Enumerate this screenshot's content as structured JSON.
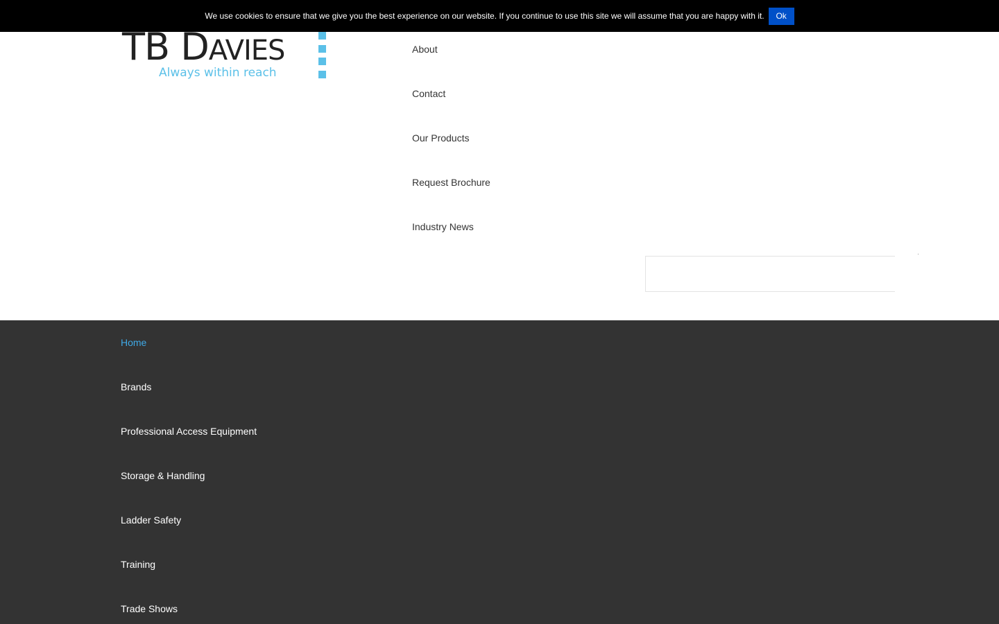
{
  "cookie_bar": {
    "message": "We use cookies to ensure that we give you the best experience on our website. If you continue to use this site we will assume that you are happy with it.",
    "ok_label": "Ok"
  },
  "logo": {
    "name_first": "TB D",
    "name_rest": "AVIES",
    "tagline": "Always within reach"
  },
  "top_nav": {
    "items": [
      "About",
      "Contact",
      "Our Products",
      "Request Brochure",
      "Industry News"
    ]
  },
  "search": {
    "value": ""
  },
  "main_nav": {
    "active_color": "#3fa9e6",
    "items": [
      {
        "label": "Home",
        "active": true
      },
      {
        "label": "Brands",
        "active": false
      },
      {
        "label": "Professional Access Equipment",
        "active": false
      },
      {
        "label": "Storage & Handling",
        "active": false
      },
      {
        "label": "Ladder Safety",
        "active": false
      },
      {
        "label": "Training",
        "active": false
      },
      {
        "label": "Trade Shows",
        "active": false
      }
    ]
  },
  "colors": {
    "cookie_bar_bg": "#000000",
    "ok_button": "#0050c8",
    "brand_accent": "#5bc0e8",
    "nav_bg": "#333333"
  }
}
